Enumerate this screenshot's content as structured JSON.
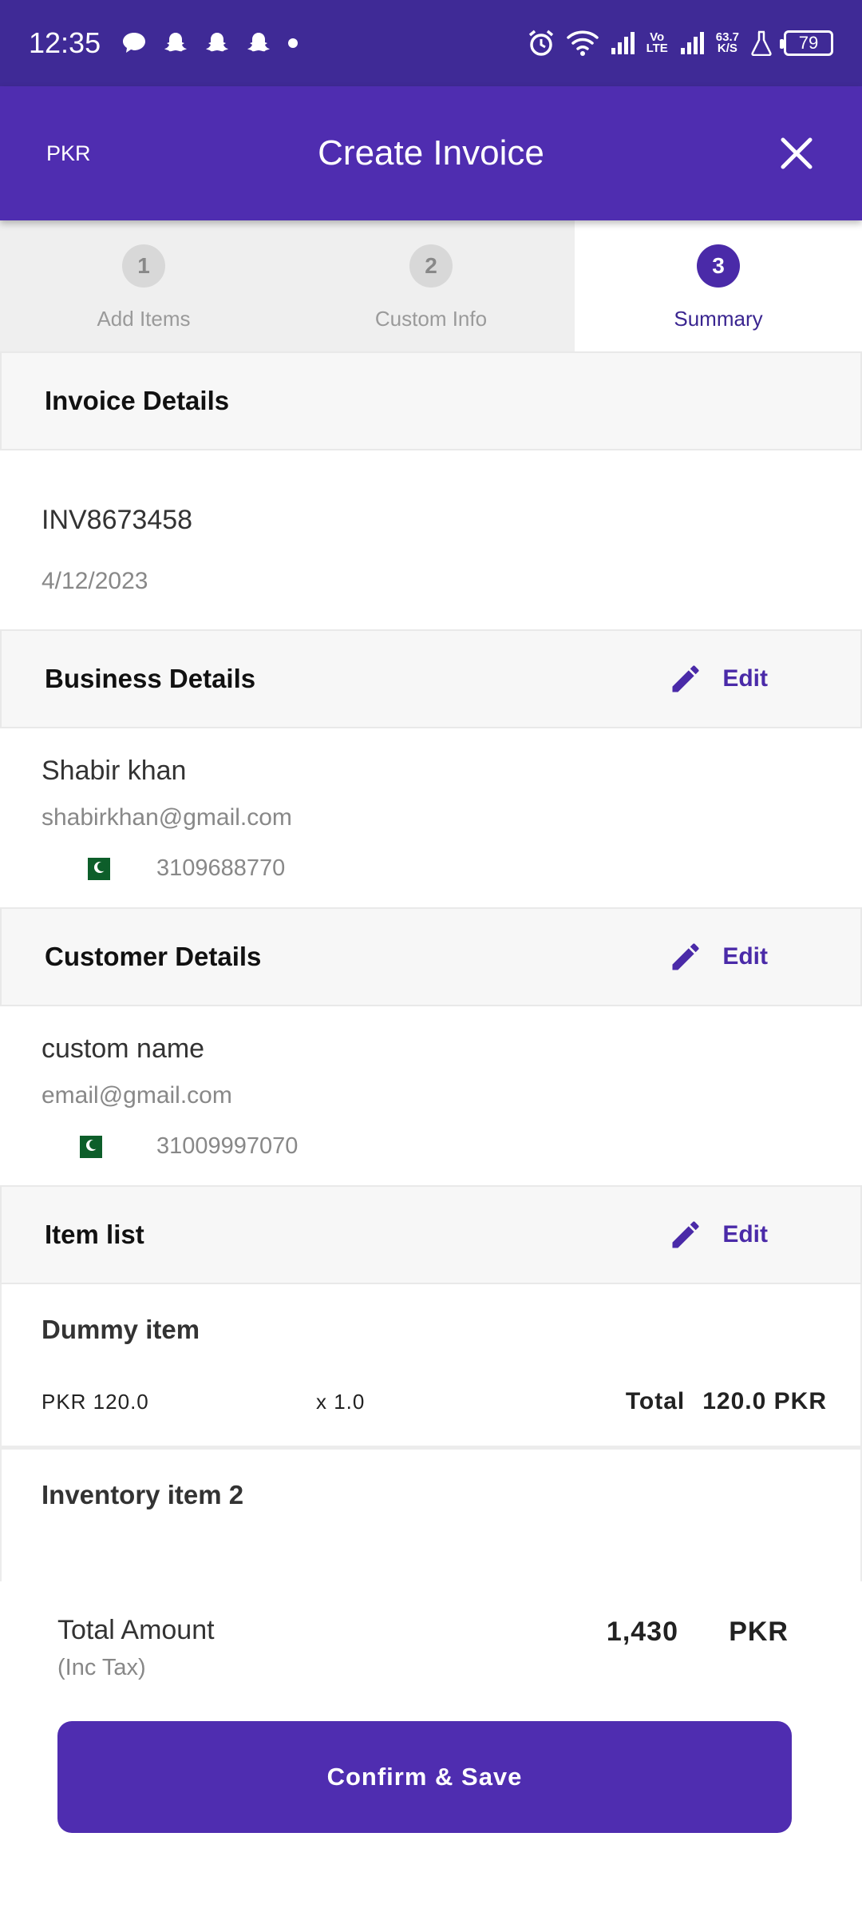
{
  "status_bar": {
    "time": "12:35",
    "network_speed_value": "63.7",
    "network_speed_unit": "K/S",
    "volte_top": "Vo",
    "volte_bottom": "LTE",
    "battery": "79"
  },
  "app_bar": {
    "currency": "PKR",
    "title": "Create Invoice"
  },
  "stepper": {
    "steps": [
      {
        "number": "1",
        "label": "Add Items"
      },
      {
        "number": "2",
        "label": "Custom Info"
      },
      {
        "number": "3",
        "label": "Summary"
      }
    ],
    "active_step": 3
  },
  "invoice_details": {
    "title": "Invoice Details",
    "invoice_number": "INV8673458",
    "date": "4/12/2023"
  },
  "business_details": {
    "title": "Business Details",
    "edit_label": "Edit",
    "name": "Shabir khan",
    "email": "shabirkhan@gmail.com",
    "phone": "3109688770"
  },
  "customer_details": {
    "title": "Customer Details",
    "edit_label": "Edit",
    "name": "custom name",
    "email": "email@gmail.com",
    "phone": "31009997070"
  },
  "item_list": {
    "title": "Item list",
    "edit_label": "Edit",
    "items": [
      {
        "name": "Dummy item",
        "price": "PKR 120.0",
        "qty": "x 1.0",
        "total_label": "Total",
        "total": "120.0 PKR"
      },
      {
        "name": "Inventory item 2"
      }
    ]
  },
  "summary": {
    "total_label": "Total Amount",
    "total_sub": "(Inc Tax)",
    "amount": "1,430",
    "currency": "PKR",
    "confirm_label": "Confirm & Save"
  },
  "colors": {
    "status_bar": "#3f2a96",
    "app_bar": "#4f2db0",
    "accent": "#4a2aa8"
  }
}
